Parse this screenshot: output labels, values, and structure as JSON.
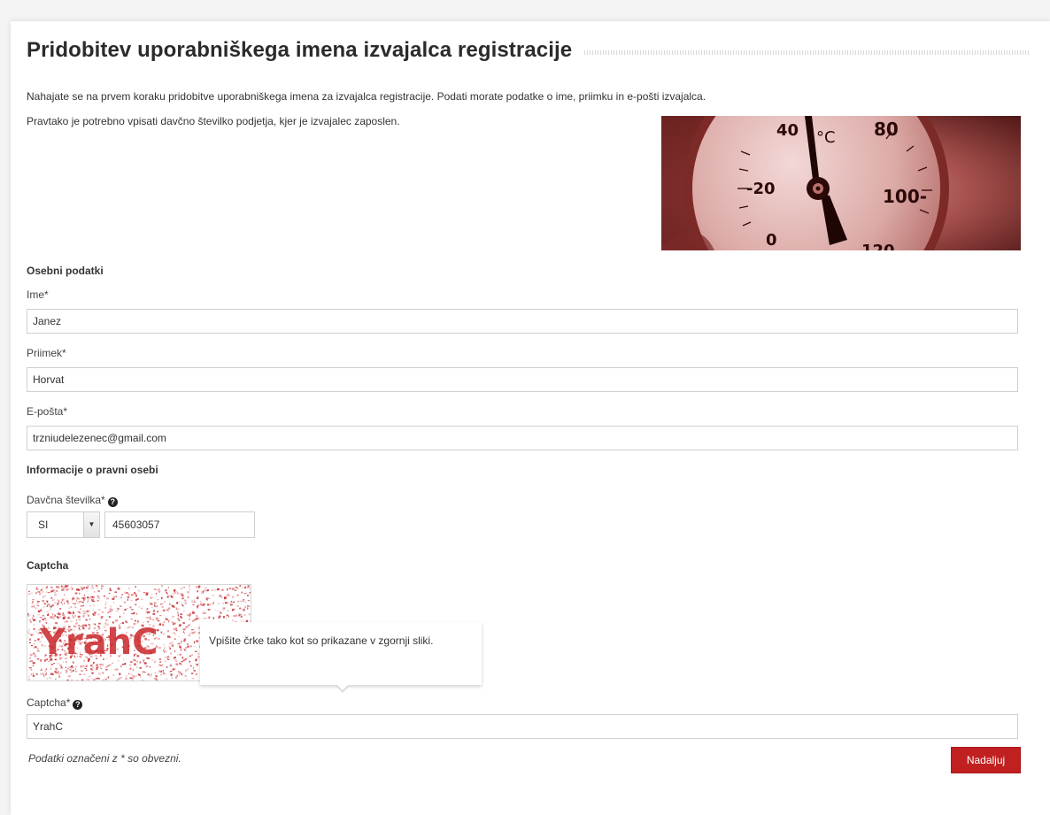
{
  "page": {
    "title": "Pridobitev uporabniškega imena izvajalca registracije",
    "intro_line1": "Nahajate se na prvem koraku pridobitve uporabniškega imena za izvajalca registracije. Podati morate podatke o ime, priimku in e-pošti izvajalca.",
    "intro_line2": "Pravtako je potrebno vpisati davčno številko podjetja, kjer je izvajalec zaposlen."
  },
  "gauge_image": {
    "icon": "thermometer-gauge-image",
    "tick_labels": [
      "40",
      "°C",
      "80",
      "-20",
      "100-",
      "0",
      "120"
    ]
  },
  "personal": {
    "heading": "Osebni podatki",
    "first_name": {
      "label": "Ime*",
      "value": "Janez"
    },
    "last_name": {
      "label": "Priimek*",
      "value": "Horvat"
    },
    "email": {
      "label": "E-pošta*",
      "value": "trzniudelezenec@gmail.com"
    }
  },
  "legal": {
    "heading": "Informacije o pravni osebi",
    "tax_label": "Davčna številka*",
    "country_selected": "SI",
    "tax_value": "45603057"
  },
  "captcha": {
    "heading": "Captcha",
    "image_text": "YrahC",
    "tooltip": "Vpišite črke tako kot so prikazane v zgornji sliki.",
    "label": "Captcha*",
    "value": "YrahC"
  },
  "footer": {
    "note": "Podatki označeni z * so obvezni.",
    "continue_label": "Nadaljuj"
  },
  "colors": {
    "accent": "#c0201f",
    "background": "#f4f4f4",
    "panel": "#ffffff"
  }
}
